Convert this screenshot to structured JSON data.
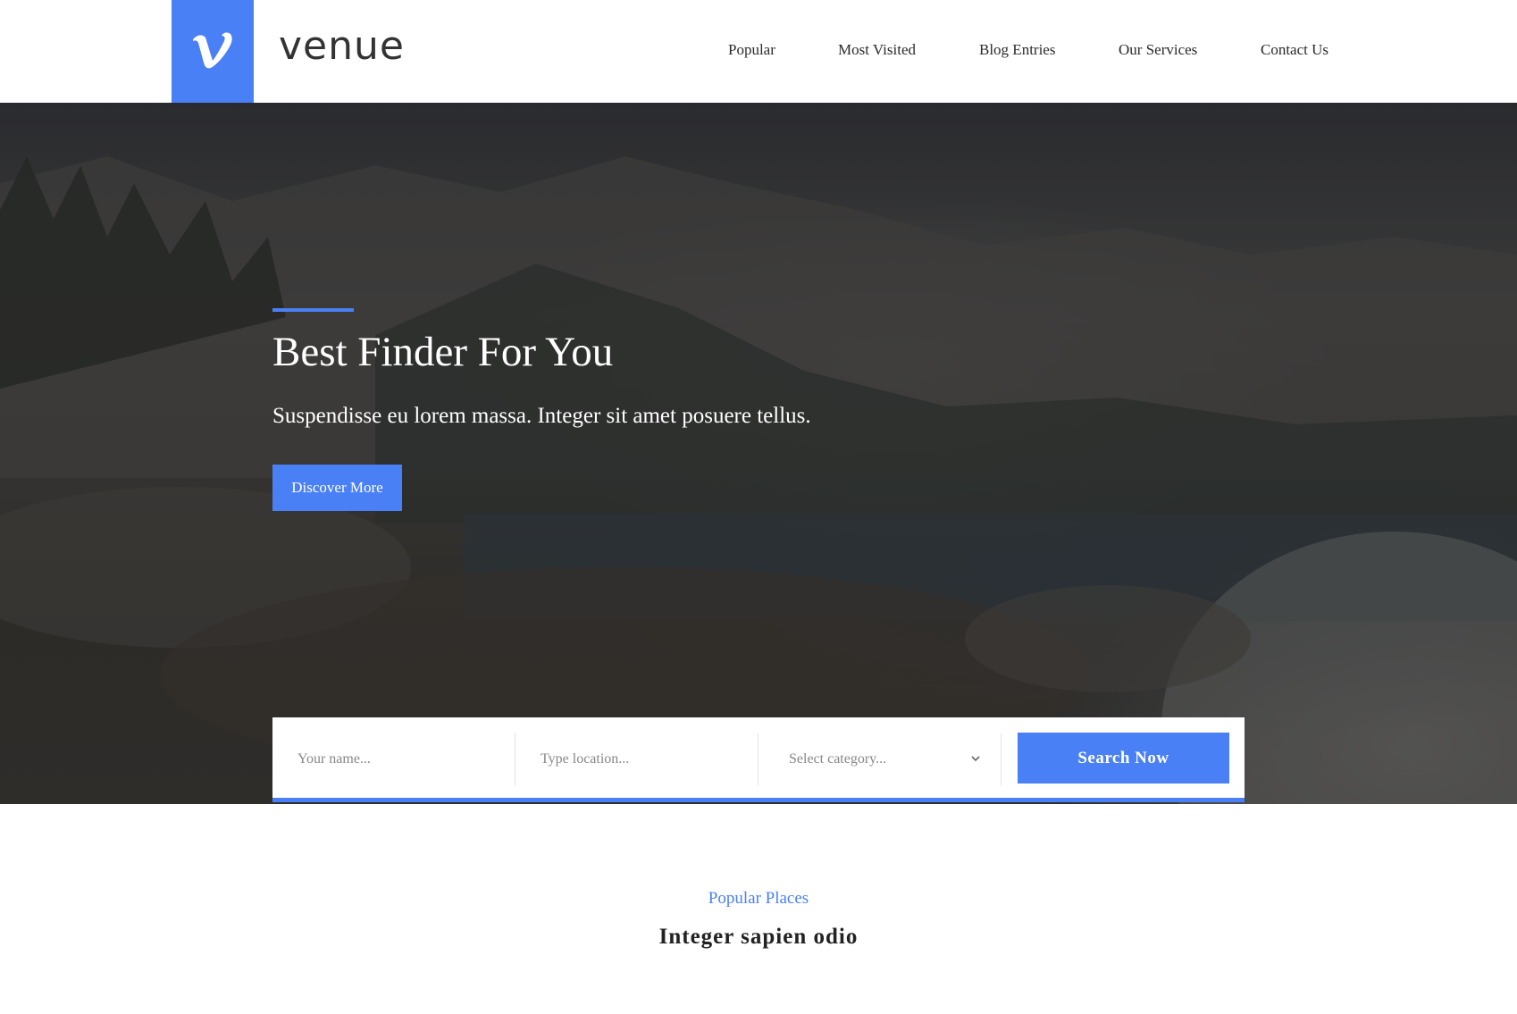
{
  "brand": {
    "name": "venue",
    "logo_icon": "vimeo-v-icon",
    "accent_color": "#4a80f5"
  },
  "nav": {
    "items": [
      "Popular",
      "Most Visited",
      "Blog Entries",
      "Our Services",
      "Contact Us"
    ]
  },
  "hero": {
    "title": "Best Finder For You",
    "subtitle": "Suspendisse eu lorem massa. Integer sit amet posuere tellus.",
    "cta_label": "Discover More"
  },
  "search": {
    "name_placeholder": "Your name...",
    "location_placeholder": "Type location...",
    "category_selected": "Select category...",
    "button_label": "Search Now"
  },
  "popular": {
    "kicker": "Popular Places",
    "title": "Integer sapien odio"
  }
}
